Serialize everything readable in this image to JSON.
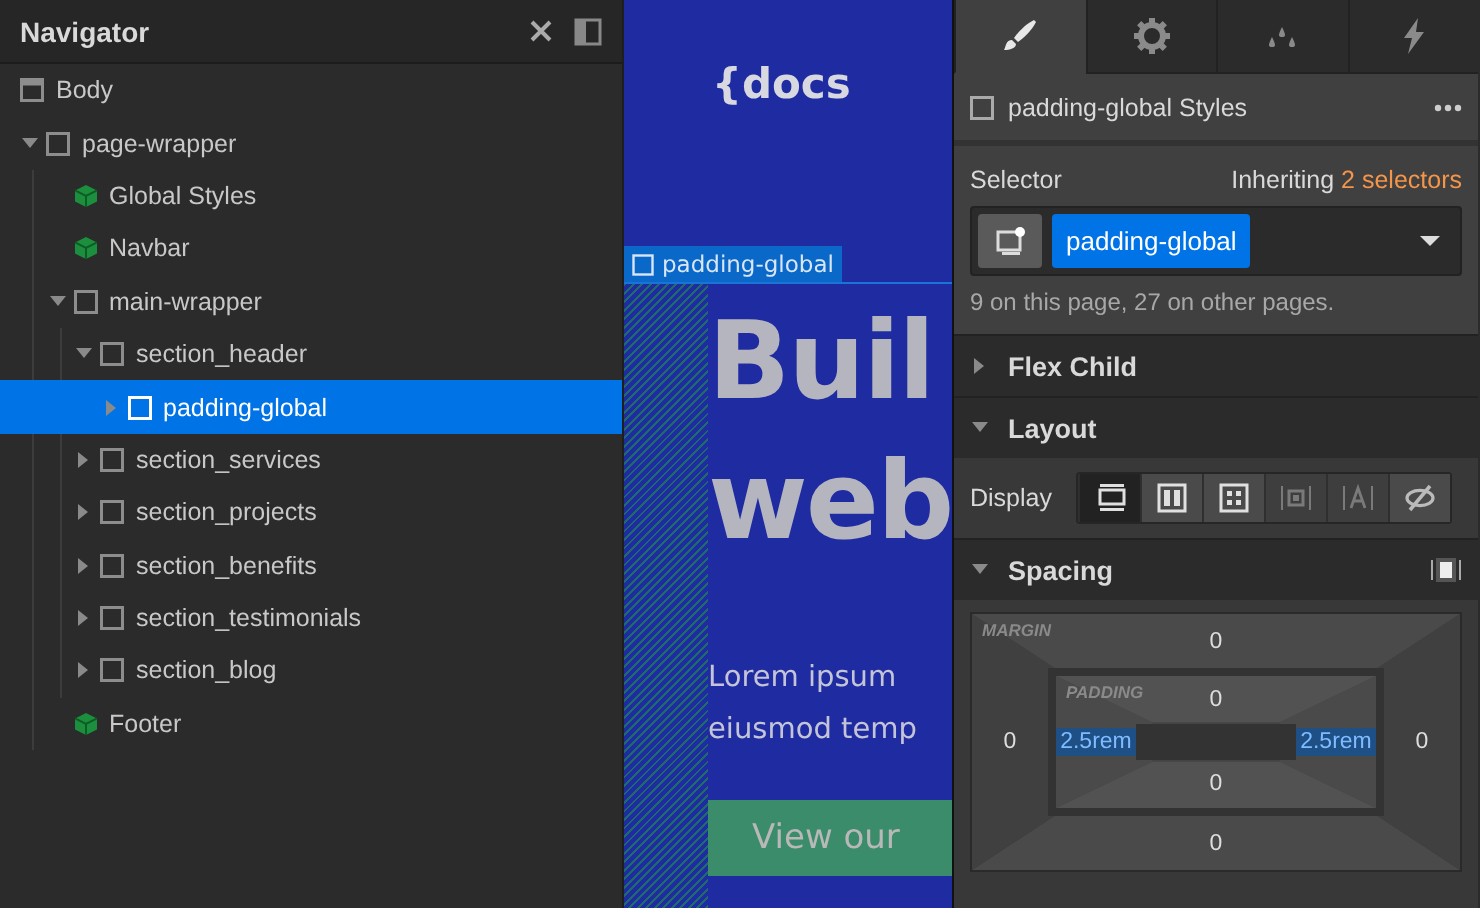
{
  "navigator": {
    "title": "Navigator",
    "tree": [
      {
        "label": "Body",
        "kind": "page",
        "selected": false,
        "children": [
          {
            "label": "page-wrapper",
            "kind": "element",
            "expanded": true,
            "selected": false,
            "children": [
              {
                "label": "Global Styles",
                "kind": "component",
                "selected": false
              },
              {
                "label": "Navbar",
                "kind": "component",
                "selected": false
              },
              {
                "label": "main-wrapper",
                "kind": "element",
                "expanded": true,
                "selected": false,
                "children": [
                  {
                    "label": "section_header",
                    "kind": "element",
                    "expanded": true,
                    "selected": false,
                    "children": [
                      {
                        "label": "padding-global",
                        "kind": "element",
                        "expanded": false,
                        "selected": true
                      }
                    ]
                  },
                  {
                    "label": "section_services",
                    "kind": "element",
                    "expanded": false,
                    "selected": false
                  },
                  {
                    "label": "section_projects",
                    "kind": "element",
                    "expanded": false,
                    "selected": false
                  },
                  {
                    "label": "section_benefits",
                    "kind": "element",
                    "expanded": false,
                    "selected": false
                  },
                  {
                    "label": "section_testimonials",
                    "kind": "element",
                    "expanded": false,
                    "selected": false
                  },
                  {
                    "label": "section_blog",
                    "kind": "element",
                    "expanded": false,
                    "selected": false
                  }
                ]
              },
              {
                "label": "Footer",
                "kind": "component",
                "selected": false
              }
            ]
          }
        ]
      }
    ]
  },
  "canvas": {
    "logo": "{docs",
    "selection_label": "padding-global",
    "heading_lines": [
      "Buil",
      "web"
    ],
    "paragraph_lines": [
      "Lorem ipsum",
      "eiusmod temp"
    ],
    "button": "View our"
  },
  "style_panel": {
    "tabs": [
      {
        "kind": "style",
        "selected": true
      },
      {
        "kind": "settings",
        "selected": false
      },
      {
        "kind": "drops",
        "selected": false
      },
      {
        "kind": "bolt",
        "selected": false
      }
    ],
    "title": "padding-global Styles",
    "selector": {
      "label": "Selector",
      "inheriting": "Inheriting",
      "inheriting_link": "2 selectors",
      "tag": "padding-global",
      "usage": "9 on this page, 27 on other pages."
    },
    "sections": [
      {
        "title": "Flex Child",
        "expanded": false
      },
      {
        "title": "Layout",
        "expanded": true,
        "display": {
          "label": "Display",
          "options": [
            {
              "kind": "block",
              "selected": true
            },
            {
              "kind": "flex",
              "selected": false
            },
            {
              "kind": "grid",
              "selected": false
            },
            {
              "kind": "inline-block",
              "selected": false
            },
            {
              "kind": "inline",
              "selected": false
            },
            {
              "kind": "none",
              "selected": false
            }
          ]
        }
      },
      {
        "title": "Spacing",
        "expanded": true,
        "box": {
          "margin_label": "MARGIN",
          "padding_label": "PADDING",
          "margin": {
            "top": {
              "value": "0",
              "set": false
            },
            "left": {
              "value": "0",
              "set": false
            },
            "right": {
              "value": "0",
              "set": false
            },
            "bottom": {
              "value": "0",
              "set": false
            }
          },
          "padding": {
            "top": {
              "value": "0",
              "set": false
            },
            "left": {
              "value": "2.5rem",
              "set": true
            },
            "right": {
              "value": "2.5rem",
              "set": true
            },
            "bottom": {
              "value": "0",
              "set": false
            }
          }
        }
      }
    ]
  }
}
